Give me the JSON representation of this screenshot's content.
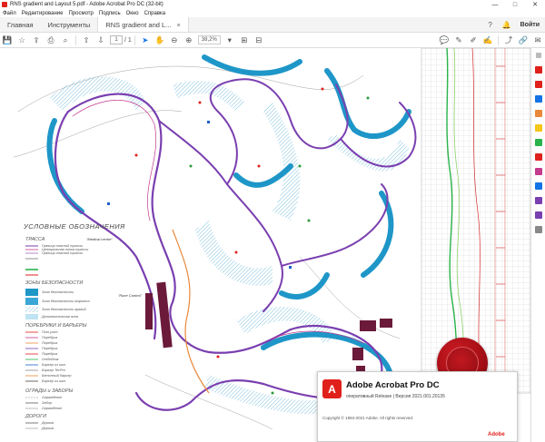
{
  "window": {
    "title": "RNS gradient and Layout 5.pdf - Adobe Acrobat Pro DC (32-bit)",
    "controls": [
      "—",
      "□",
      "✕"
    ]
  },
  "menu": [
    "Файл",
    "Редактирование",
    "Просмотр",
    "Подпись",
    "Окно",
    "Справка"
  ],
  "tabs": {
    "home": "Главная",
    "tools": "Инструменты",
    "document": "RNS gradient and L...",
    "document_close": "×",
    "signin": "Войти"
  },
  "toolbar": {
    "page_current": "1",
    "page_total": "/ 1",
    "zoom": "38,2%"
  },
  "legend": {
    "title": "УСЛОВНЫЕ ОБОЗНАЧЕНИЯ",
    "track_heading": "ТРАССА",
    "safety_heading": "ЗОНЫ БЕЗОПАСНОСТИ",
    "barriers_heading": "ПОРЕБРИКИ И БАРЬЕРЫ",
    "fences_heading": "ОГРАДЫ и ЗАБОРЫ",
    "roads_heading": "ДОРОГИ",
    "track_items": [
      "Граница опасной трассы",
      "Центральная линия трассы",
      "Граница опасной трассы"
    ],
    "safety_items": [
      "Зона безопасности",
      "Зона безопасности асфальт",
      "Зона безопасности гравий",
      "Дополнительная зона"
    ],
    "barrier_items": [
      "Пит-уолл",
      "Поребрик",
      "Поребрик",
      "Поребрик",
      "Поребрик",
      "Отбойник",
      "Барьер из шин",
      "Барьер TecPro",
      "Бетонный барьер",
      "Барьер из шин"
    ],
    "fence_items": [
      "Ограждение",
      "Забор",
      "Ограждение"
    ],
    "road_items": [
      "Дорога",
      "Дорога"
    ]
  },
  "map_labels": {
    "medical": "\"Medical centre\"",
    "race_control": "\"Race Control\""
  },
  "splash": {
    "product": "Adobe Acrobat Pro DC",
    "info": "оперативный Release | Версия 2021.001.20135",
    "copyright": "Copyright © 1984-2021 Adobe. All rights reserved.",
    "brand": "Adobe"
  },
  "colors": {
    "track": "#7a3fb0",
    "track_edge": "#c43a8c",
    "safety_zone": "#1e96c8",
    "safety_hatch": "#5ab0d6",
    "pit_buildings": "#6b1a3a",
    "adobe_red": "#e0201b"
  }
}
